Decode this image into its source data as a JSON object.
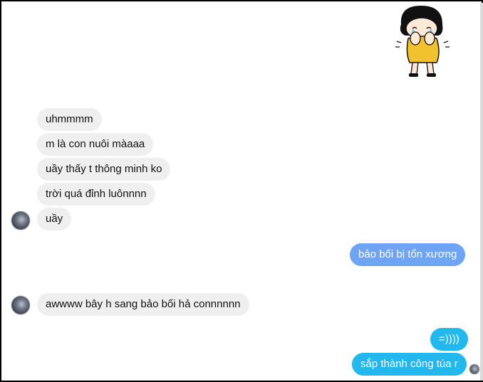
{
  "sticker": {
    "icon": "crying-girl-sticker"
  },
  "messages": [
    {
      "from": "them",
      "text": "uhmmmm"
    },
    {
      "from": "them",
      "text": "m là con nuôi màaaa"
    },
    {
      "from": "them",
      "text": "uầy thấy t thông minh ko"
    },
    {
      "from": "them",
      "text": "trời quá đỉnh luônnnn"
    },
    {
      "from": "them",
      "text": "uầy"
    },
    {
      "from": "me",
      "text": "bảo bối bị tổn xương"
    },
    {
      "from": "them",
      "text": "awwww bây h sang bảo bối hả connnnnn"
    },
    {
      "from": "me",
      "text": "=))))"
    },
    {
      "from": "me",
      "text": "sắp thành công túa r"
    }
  ],
  "colors": {
    "incoming": "#efefef",
    "outgoing_blue": "#6fa4f5",
    "outgoing_cyan": "#22b8ee"
  }
}
